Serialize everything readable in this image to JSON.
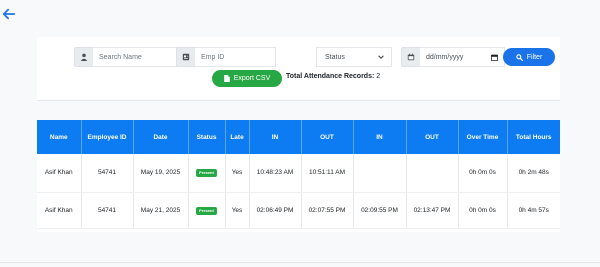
{
  "filters": {
    "search_name_placeholder": "Search Name",
    "emp_id_placeholder": "Emp ID",
    "status_value": "Status",
    "date_placeholder": "dd/mm/yyyy",
    "filter_label": "Filter"
  },
  "actions": {
    "export_label": "Export CSV",
    "total_label": "Total Attendance Records:",
    "total_value": "2"
  },
  "table": {
    "headers": [
      "Name",
      "Employee ID",
      "Date",
      "Status",
      "Late",
      "IN",
      "OUT",
      "IN",
      "OUT",
      "Over Time",
      "Total Hours"
    ],
    "rows": [
      {
        "name": "Asif Khan",
        "emp_id": "54741",
        "date": "May 19, 2025",
        "status": "Present",
        "late": "Yes",
        "in1": "10:48:23 AM",
        "out1": "10:51:11 AM",
        "in2": "",
        "out2": "",
        "overtime": "0h 0m 0s",
        "total": "0h 2m 48s"
      },
      {
        "name": "Asif Khan",
        "emp_id": "54741",
        "date": "May 21, 2025",
        "status": "Present",
        "late": "Yes",
        "in1": "02:06:49 PM",
        "out1": "02:07:55 PM",
        "in2": "02:09:55 PM",
        "out2": "02:13:47 PM",
        "overtime": "0h 0m 0s",
        "total": "0h 4m 57s"
      }
    ]
  },
  "colors": {
    "primary": "#0d7cf2",
    "success": "#28a745"
  },
  "icons": [
    "back-arrow-icon",
    "user-icon",
    "id-card-icon",
    "calendar-icon",
    "chevron-down-icon",
    "search-icon",
    "file-icon"
  ]
}
